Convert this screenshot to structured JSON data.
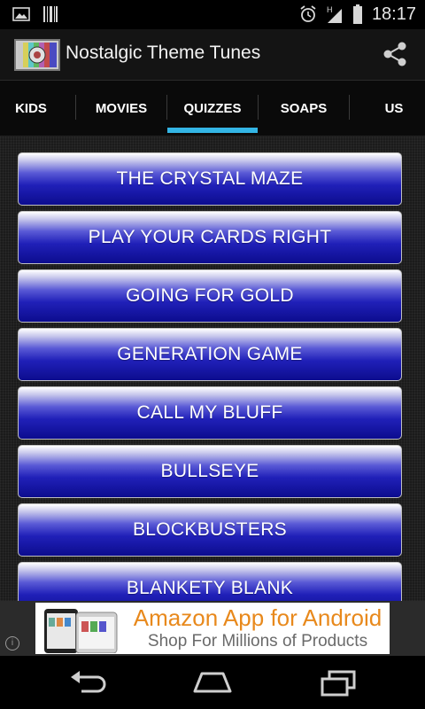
{
  "status": {
    "time": "18:17"
  },
  "app": {
    "title": "Nostalgic Theme Tunes"
  },
  "tabs": [
    {
      "label": "KIDS"
    },
    {
      "label": "MOVIES"
    },
    {
      "label": "QUIZZES",
      "selected": true
    },
    {
      "label": "SOAPS"
    },
    {
      "label": "US"
    }
  ],
  "items": [
    {
      "label": "THE CRYSTAL MAZE"
    },
    {
      "label": "PLAY YOUR CARDS RIGHT"
    },
    {
      "label": "GOING FOR GOLD"
    },
    {
      "label": "GENERATION GAME"
    },
    {
      "label": "CALL MY BLUFF"
    },
    {
      "label": "BULLSEYE"
    },
    {
      "label": "BLOCKBUSTERS"
    },
    {
      "label": "BLANKETY BLANK"
    }
  ],
  "ad": {
    "info": "i",
    "headline": "Amazon App for Android",
    "subline": "Shop For Millions of Products"
  },
  "colors": {
    "accent": "#33b5e5",
    "ad_headline": "#e8891c",
    "button_blue": "#2020b8"
  }
}
